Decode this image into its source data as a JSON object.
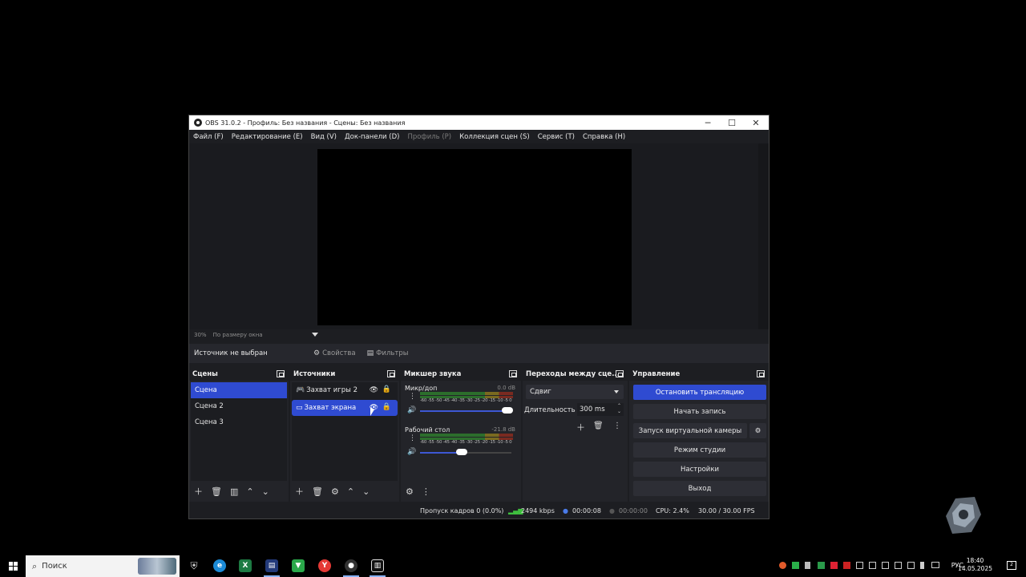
{
  "window": {
    "title": "OBS 31.0.2 - Профиль: Без названия - Сцены: Без названия",
    "minimize": "─",
    "maximize": "☐",
    "close": "✕"
  },
  "menu": [
    {
      "label": "Файл (F)",
      "disabled": false
    },
    {
      "label": "Редактирование (E)",
      "disabled": false
    },
    {
      "label": "Вид (V)",
      "disabled": false
    },
    {
      "label": "Док-панели (D)",
      "disabled": false
    },
    {
      "label": "Профиль (P)",
      "disabled": true
    },
    {
      "label": "Коллекция сцен (S)",
      "disabled": false
    },
    {
      "label": "Сервис (T)",
      "disabled": false
    },
    {
      "label": "Справка (H)",
      "disabled": false
    }
  ],
  "zoom": {
    "value": "30%",
    "mode": "По размеру окна"
  },
  "source_bar": {
    "no_source": "Источник не выбран",
    "properties": "Свойства",
    "filters": "Фильтры"
  },
  "scenes": {
    "title": "Сцены",
    "items": [
      {
        "label": "Сцена",
        "selected": true
      },
      {
        "label": "Сцена 2",
        "selected": false
      },
      {
        "label": "Сцена 3",
        "selected": false
      }
    ]
  },
  "sources": {
    "title": "Источники",
    "items": [
      {
        "label": "Захват игры 2",
        "icon": "gamepad-icon",
        "selected": false
      },
      {
        "label": "Захват экрана",
        "icon": "monitor-icon",
        "selected": true
      }
    ]
  },
  "mixer": {
    "title": "Микшер звука",
    "channels": [
      {
        "name": "Микр/доп",
        "db": "0.0 dB",
        "volume": 1.0
      },
      {
        "name": "Рабочий стол",
        "db": "-21.8 dB",
        "volume": 0.48
      }
    ],
    "ticks": "-60 -55 -50 -45 -40 -35 -30 -25 -20 -15 -10 -5 0"
  },
  "transitions": {
    "title": "Переходы между сце...",
    "type": "Сдвиг",
    "duration_label": "Длительность",
    "duration_value": "300 ms"
  },
  "controls": {
    "title": "Управление",
    "stop_stream": "Остановить трансляцию",
    "start_record": "Начать запись",
    "virtual_cam": "Запуск виртуальной камеры",
    "studio_mode": "Режим студии",
    "settings": "Настройки",
    "exit": "Выход"
  },
  "status": {
    "dropped": "Пропуск кадров 0 (0.0%)",
    "bitrate": "2494 kbps",
    "stream_time": "00:00:08",
    "record_time": "00:00:00",
    "cpu": "CPU: 2.4%",
    "fps": "30.00 / 30.00 FPS"
  },
  "taskbar": {
    "search_placeholder": "Поиск",
    "lang": "РУС",
    "time": "18:40",
    "date": "14.05.2025",
    "notifications": "2"
  },
  "colors": {
    "accent": "#2f4bd1",
    "panel": "#232429",
    "background": "#1d1e22"
  }
}
